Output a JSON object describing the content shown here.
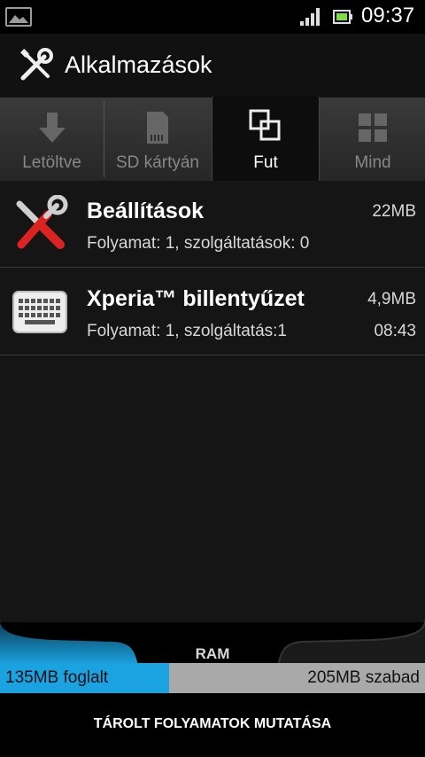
{
  "status_bar": {
    "time": "09:37",
    "icons": [
      "picture-icon",
      "signal-icon",
      "battery-icon"
    ]
  },
  "title_bar": {
    "title": "Alkalmazások",
    "icon": "tools-icon"
  },
  "tabs": [
    {
      "label": "Letöltve",
      "icon": "download-arrow-icon",
      "active": false
    },
    {
      "label": "SD kártyán",
      "icon": "sd-card-icon",
      "active": false
    },
    {
      "label": "Fut",
      "icon": "running-windows-icon",
      "active": true
    },
    {
      "label": "Mind",
      "icon": "grid-icon",
      "active": false
    }
  ],
  "processes": [
    {
      "name": "Beállítások",
      "detail": "Folyamat: 1, szolgáltatások: 0",
      "size": "22MB",
      "time": "",
      "icon": "settings-tools-icon"
    },
    {
      "name": "Xperia™ billentyűzet",
      "detail": "Folyamat: 1, szolgáltatás:1",
      "size": "4,9MB",
      "time": "08:43",
      "icon": "keyboard-icon"
    }
  ],
  "ram": {
    "label": "RAM",
    "used_text": "135MB foglalt",
    "free_text": "205MB szabad",
    "used_fraction": 0.397
  },
  "bottom_button": {
    "label": "TÁROLT FOLYAMATOK MUTATÁSA"
  },
  "colors": {
    "accent": "#1aa3e0",
    "free_bar": "#a9a9a9",
    "background": "#151515"
  }
}
